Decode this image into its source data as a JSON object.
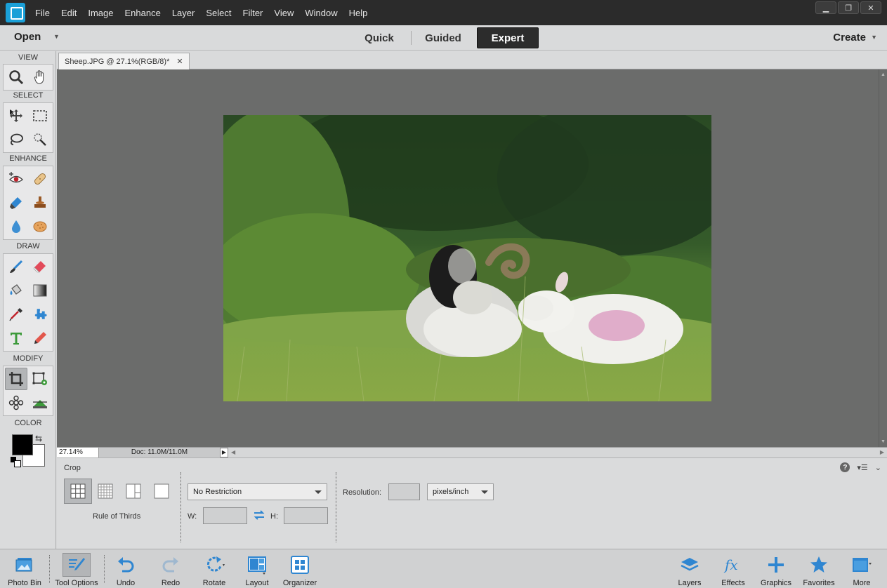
{
  "menubar": {
    "items": [
      "File",
      "Edit",
      "Image",
      "Enhance",
      "Layer",
      "Select",
      "Filter",
      "View",
      "Window",
      "Help"
    ],
    "window_controls": [
      "▁",
      "❐",
      "✕"
    ]
  },
  "modebar": {
    "open_label": "Open",
    "tabs": [
      "Quick",
      "Guided",
      "Expert"
    ],
    "active_tab": "Expert",
    "create_label": "Create"
  },
  "toolbox": {
    "sections": [
      "VIEW",
      "SELECT",
      "ENHANCE",
      "DRAW",
      "MODIFY",
      "COLOR"
    ],
    "foreground_color": "#000000",
    "background_color": "#ffffff"
  },
  "document": {
    "tab_title": "Sheep.JPG @ 27.1%(RGB/8)*",
    "zoom": "27.14%",
    "doc_size": "Doc: 11.0M/11.0M"
  },
  "tool_options": {
    "tool_name": "Crop",
    "overlay_label": "Rule of Thirds",
    "preset": "No Restriction",
    "width_label": "W:",
    "height_label": "H:",
    "resolution_label": "Resolution:",
    "resolution_unit": "pixels/inch"
  },
  "taskbar": {
    "left": [
      "Photo Bin",
      "Tool Options",
      "Undo",
      "Redo",
      "Rotate",
      "Layout",
      "Organizer"
    ],
    "right": [
      "Layers",
      "Effects",
      "Graphics",
      "Favorites",
      "More"
    ]
  },
  "colors": {
    "accent": "#1a8fd4",
    "menubar": "#2b2b2b",
    "canvas": "#6b6c6b"
  }
}
